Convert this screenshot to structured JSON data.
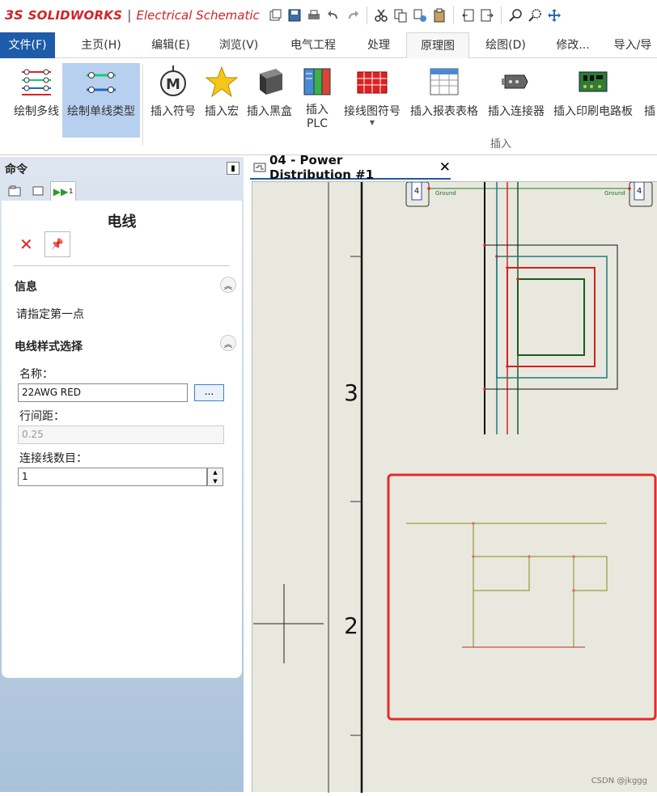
{
  "app": {
    "brand_ds": "3S",
    "brand": "SOLIDWORKS",
    "separator": "|",
    "product": "Electrical Schematic"
  },
  "menubar": {
    "items": [
      "文件(F)",
      "主页(H)",
      "编辑(E)",
      "浏览(V)",
      "电气工程",
      "处理",
      "原理图",
      "绘图(D)",
      "修改...",
      "导入/导"
    ]
  },
  "ribbon": {
    "buttons": [
      {
        "label": "绘制多线",
        "icon": "multi-wire-icon"
      },
      {
        "label": "绘制单线类型",
        "icon": "single-wire-icon"
      },
      {
        "label": "插入符号",
        "icon": "motor-symbol-icon"
      },
      {
        "label": "插入宏",
        "icon": "star-macro-icon"
      },
      {
        "label": "插入黑盒",
        "icon": "black-box-icon"
      },
      {
        "label": "插入\nPLC",
        "icon": "plc-icon"
      },
      {
        "label": "接线图符号",
        "icon": "terminal-strip-icon"
      },
      {
        "label": "插入报表表格",
        "icon": "report-table-icon"
      },
      {
        "label": "插入连接器",
        "icon": "connector-icon"
      },
      {
        "label": "插入印刷电路板",
        "icon": "pcb-icon"
      },
      {
        "label": "插",
        "icon": "more-icon"
      }
    ],
    "group_label": "插入"
  },
  "command_panel": {
    "title": "命令",
    "tab3_number": "1",
    "property_title": "电线",
    "info_header": "信息",
    "info_text": "请指定第一点",
    "style_header": "电线样式选择",
    "name_label": "名称：",
    "name_value": "22AWG RED",
    "browse_label": "...",
    "spacing_label": "行间距：",
    "spacing_value": "0.25",
    "count_label": "连接线数目：",
    "count_value": "1"
  },
  "document": {
    "tab_title": "04 - Power Distribution #1",
    "close_glyph": "✕",
    "row_labels": [
      "3",
      "2"
    ],
    "terminal_number": "4",
    "terminal_caption": "Ground"
  },
  "watermark": "CSDN @jkggg",
  "colors": {
    "accent": "#1e5ba8",
    "highlight": "#e52a2a",
    "canvas": "#e8e8df",
    "wire_red": "#d42020",
    "wire_teal": "#1d7a80",
    "wire_green": "#1c5a1c",
    "wire_olive": "#8a8a10"
  }
}
